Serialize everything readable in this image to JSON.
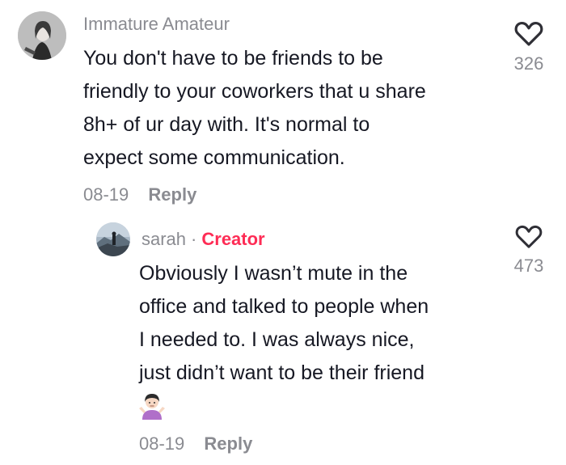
{
  "comment": {
    "username": "Immature Amateur",
    "text_lines": [
      "You don't have to be friends to be",
      "friendly to your coworkers that u share",
      "8h+ of ur day with. It's normal to",
      "expect some communication."
    ],
    "date": "08-19",
    "reply_label": "Reply",
    "like_count": "326",
    "like_icon": "heart-outline-icon"
  },
  "reply": {
    "username": "sarah",
    "separator": "·",
    "badge": "Creator",
    "text_lines": [
      "Obviously I wasn’t mute in the",
      "office and talked to people when",
      "I needed to. I was always nice,",
      "just didn’t want to be their friend"
    ],
    "emoji_icon": "person-shrugging-emoji-icon",
    "date": "08-19",
    "reply_label": "Reply",
    "like_count": "473",
    "like_icon": "heart-outline-icon"
  },
  "colors": {
    "secondary_text": "#8a8b91",
    "primary_text": "#161823",
    "creator_badge": "#fe2c55"
  }
}
